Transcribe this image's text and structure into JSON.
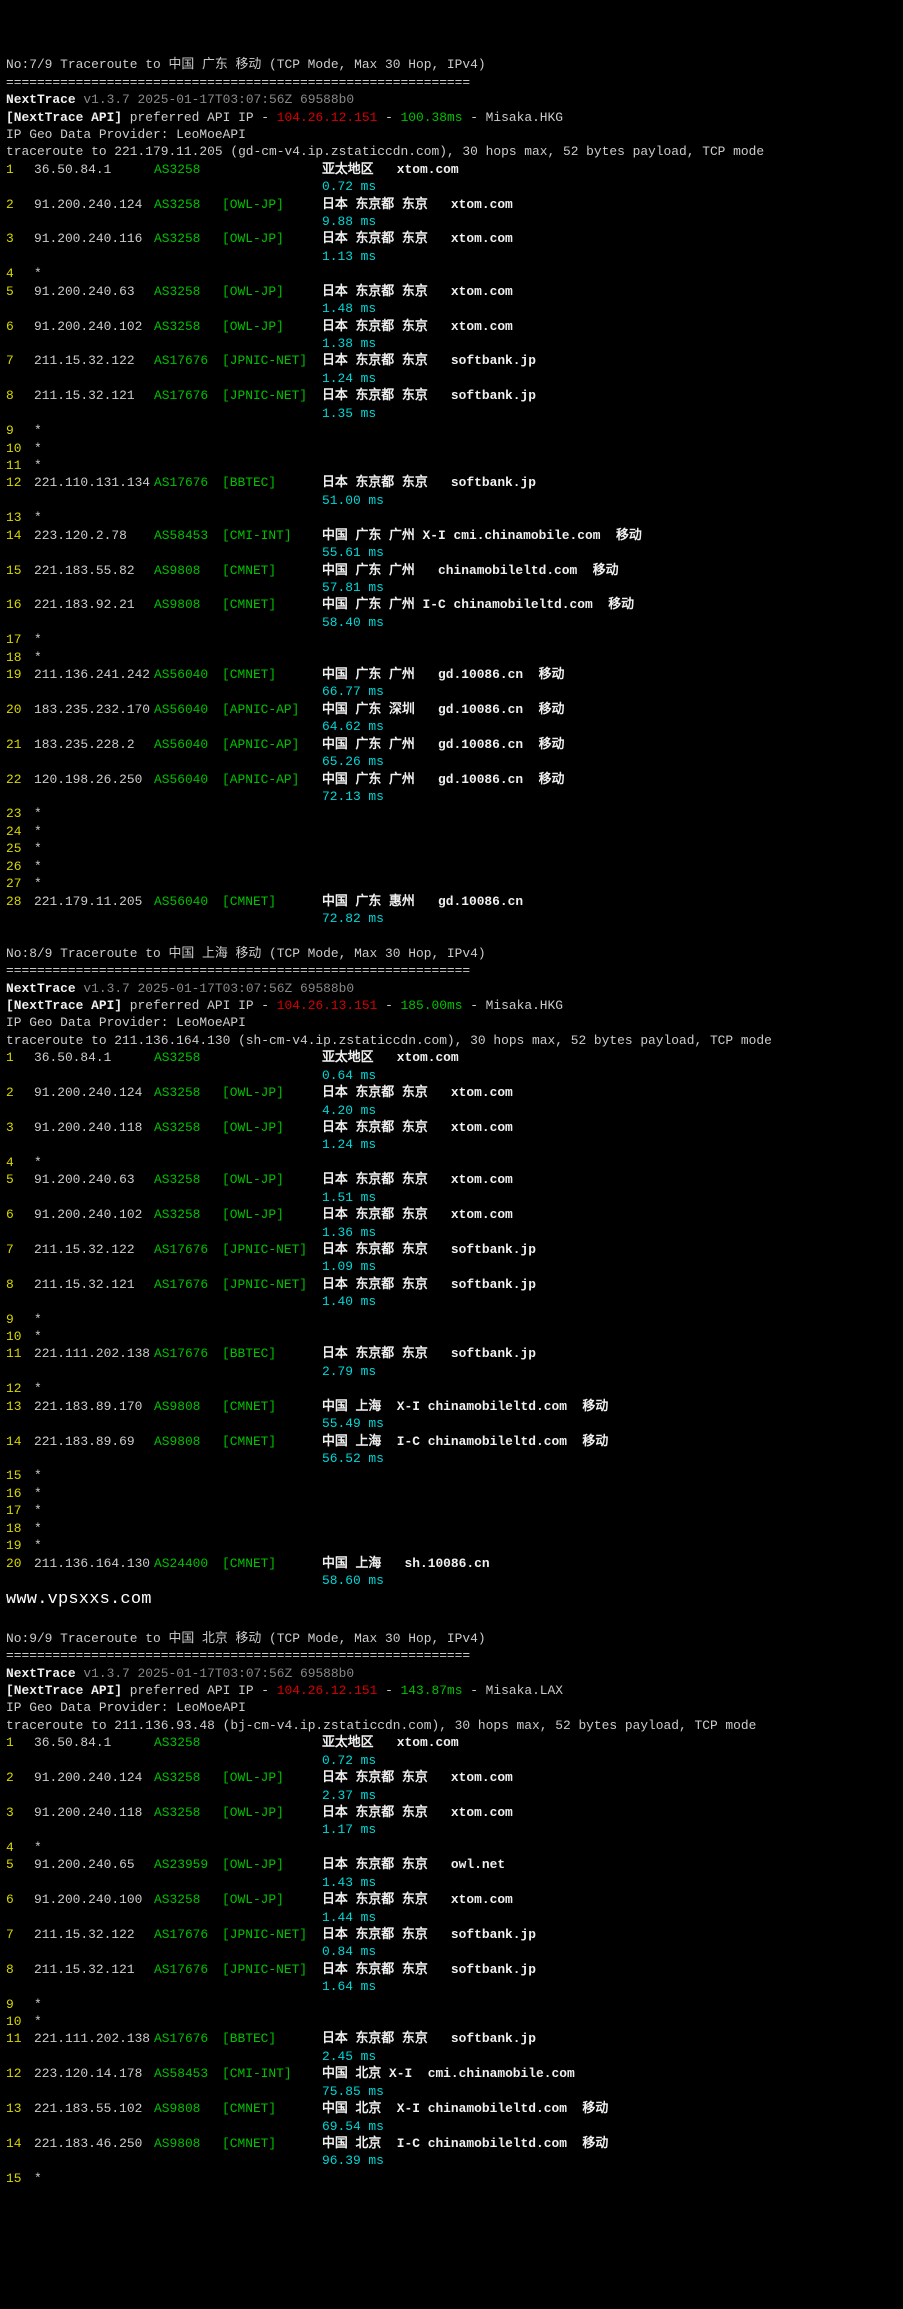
{
  "traces": [
    {
      "header": "No:7/9 Traceroute to 中国 广东 移动 (TCP Mode, Max 30 Hop, IPv4)",
      "sep": "============================================================",
      "nt_label": "NextTrace",
      "nt_ver": "v1.3.7 2025-01-17T03:07:56Z 69588b0",
      "api_tag": "[NextTrace API]",
      "api_txt": " preferred API IP - ",
      "api_ip": "104.26.12.151",
      "api_dash": " - ",
      "api_ms": "100.38ms",
      "api_loc": " - Misaka.HKG",
      "geo": "IP Geo Data Provider: LeoMoeAPI",
      "tline": "traceroute to 221.179.11.205 (gd-cm-v4.ip.zstaticcdn.com), 30 hops max, 52 bytes payload, TCP mode",
      "hops": [
        {
          "n": "1",
          "ip": "36.50.84.1",
          "as": "AS3258",
          "tag": "",
          "loc": "亚太地区   xtom.com",
          "ms": "0.72 ms"
        },
        {
          "n": "2",
          "ip": "91.200.240.124",
          "as": "AS3258",
          "tag": "[OWL-JP]",
          "loc": "日本 东京都 东京   xtom.com",
          "ms": "9.88 ms"
        },
        {
          "n": "3",
          "ip": "91.200.240.116",
          "as": "AS3258",
          "tag": "[OWL-JP]",
          "loc": "日本 东京都 东京   xtom.com",
          "ms": "1.13 ms"
        },
        {
          "n": "4",
          "ip": "*"
        },
        {
          "n": "5",
          "ip": "91.200.240.63",
          "as": "AS3258",
          "tag": "[OWL-JP]",
          "loc": "日本 东京都 东京   xtom.com",
          "ms": "1.48 ms"
        },
        {
          "n": "6",
          "ip": "91.200.240.102",
          "as": "AS3258",
          "tag": "[OWL-JP]",
          "loc": "日本 东京都 东京   xtom.com",
          "ms": "1.38 ms"
        },
        {
          "n": "7",
          "ip": "211.15.32.122",
          "as": "AS17676",
          "tag": "[JPNIC-NET]",
          "loc": "日本 东京都 东京   softbank.jp",
          "ms": "1.24 ms"
        },
        {
          "n": "8",
          "ip": "211.15.32.121",
          "as": "AS17676",
          "tag": "[JPNIC-NET]",
          "loc": "日本 东京都 东京   softbank.jp",
          "ms": "1.35 ms"
        },
        {
          "n": "9",
          "ip": "*"
        },
        {
          "n": "10",
          "ip": "*"
        },
        {
          "n": "11",
          "ip": "*"
        },
        {
          "n": "12",
          "ip": "221.110.131.134",
          "as": "AS17676",
          "tag": "[BBTEC]",
          "loc": "日本 东京都 东京   softbank.jp",
          "ms": "51.00 ms"
        },
        {
          "n": "13",
          "ip": "*"
        },
        {
          "n": "14",
          "ip": "223.120.2.78",
          "as": "AS58453",
          "tag": "[CMI-INT]",
          "loc": "中国 广东 广州 X-I cmi.chinamobile.com  移动",
          "ms": "55.61 ms"
        },
        {
          "n": "15",
          "ip": "221.183.55.82",
          "as": "AS9808",
          "tag": "[CMNET]",
          "loc": "中国 广东 广州   chinamobileltd.com  移动",
          "ms": "57.81 ms"
        },
        {
          "n": "16",
          "ip": "221.183.92.21",
          "as": "AS9808",
          "tag": "[CMNET]",
          "loc": "中国 广东 广州 I-C chinamobileltd.com  移动",
          "ms": "58.40 ms"
        },
        {
          "n": "17",
          "ip": "*"
        },
        {
          "n": "18",
          "ip": "*"
        },
        {
          "n": "19",
          "ip": "211.136.241.242",
          "as": "AS56040",
          "tag": "[CMNET]",
          "loc": "中国 广东 广州   gd.10086.cn  移动",
          "ms": "66.77 ms"
        },
        {
          "n": "20",
          "ip": "183.235.232.170",
          "as": "AS56040",
          "tag": "[APNIC-AP]",
          "loc": "中国 广东 深圳   gd.10086.cn  移动",
          "ms": "64.62 ms"
        },
        {
          "n": "21",
          "ip": "183.235.228.2",
          "as": "AS56040",
          "tag": "[APNIC-AP]",
          "loc": "中国 广东 广州   gd.10086.cn  移动",
          "ms": "65.26 ms"
        },
        {
          "n": "22",
          "ip": "120.198.26.250",
          "as": "AS56040",
          "tag": "[APNIC-AP]",
          "loc": "中国 广东 广州   gd.10086.cn  移动",
          "ms": "72.13 ms"
        },
        {
          "n": "23",
          "ip": "*"
        },
        {
          "n": "24",
          "ip": "*"
        },
        {
          "n": "25",
          "ip": "*"
        },
        {
          "n": "26",
          "ip": "*"
        },
        {
          "n": "27",
          "ip": "*"
        },
        {
          "n": "28",
          "ip": "221.179.11.205",
          "as": "AS56040",
          "tag": "[CMNET]",
          "loc": "中国 广东 惠州   gd.10086.cn",
          "ms": "72.82 ms"
        }
      ]
    },
    {
      "header": "No:8/9 Traceroute to 中国 上海 移动 (TCP Mode, Max 30 Hop, IPv4)",
      "sep": "============================================================",
      "nt_label": "NextTrace",
      "nt_ver": "v1.3.7 2025-01-17T03:07:56Z 69588b0",
      "api_tag": "[NextTrace API]",
      "api_txt": " preferred API IP - ",
      "api_ip": "104.26.13.151",
      "api_dash": " - ",
      "api_ms": "185.00ms",
      "api_loc": " - Misaka.HKG",
      "geo": "IP Geo Data Provider: LeoMoeAPI",
      "tline": "traceroute to 211.136.164.130 (sh-cm-v4.ip.zstaticcdn.com), 30 hops max, 52 bytes payload, TCP mode",
      "hops": [
        {
          "n": "1",
          "ip": "36.50.84.1",
          "as": "AS3258",
          "tag": "",
          "loc": "亚太地区   xtom.com",
          "ms": "0.64 ms"
        },
        {
          "n": "2",
          "ip": "91.200.240.124",
          "as": "AS3258",
          "tag": "[OWL-JP]",
          "loc": "日本 东京都 东京   xtom.com",
          "ms": "4.20 ms"
        },
        {
          "n": "3",
          "ip": "91.200.240.118",
          "as": "AS3258",
          "tag": "[OWL-JP]",
          "loc": "日本 东京都 东京   xtom.com",
          "ms": "1.24 ms"
        },
        {
          "n": "4",
          "ip": "*"
        },
        {
          "n": "5",
          "ip": "91.200.240.63",
          "as": "AS3258",
          "tag": "[OWL-JP]",
          "loc": "日本 东京都 东京   xtom.com",
          "ms": "1.51 ms"
        },
        {
          "n": "6",
          "ip": "91.200.240.102",
          "as": "AS3258",
          "tag": "[OWL-JP]",
          "loc": "日本 东京都 东京   xtom.com",
          "ms": "1.36 ms"
        },
        {
          "n": "7",
          "ip": "211.15.32.122",
          "as": "AS17676",
          "tag": "[JPNIC-NET]",
          "loc": "日本 东京都 东京   softbank.jp",
          "ms": "1.09 ms"
        },
        {
          "n": "8",
          "ip": "211.15.32.121",
          "as": "AS17676",
          "tag": "[JPNIC-NET]",
          "loc": "日本 东京都 东京   softbank.jp",
          "ms": "1.40 ms"
        },
        {
          "n": "9",
          "ip": "*"
        },
        {
          "n": "10",
          "ip": "*"
        },
        {
          "n": "11",
          "ip": "221.111.202.138",
          "as": "AS17676",
          "tag": "[BBTEC]",
          "loc": "日本 东京都 东京   softbank.jp",
          "ms": "2.79 ms"
        },
        {
          "n": "12",
          "ip": "*"
        },
        {
          "n": "13",
          "ip": "221.183.89.170",
          "as": "AS9808",
          "tag": "[CMNET]",
          "loc": "中国 上海  X-I chinamobileltd.com  移动",
          "ms": "55.49 ms"
        },
        {
          "n": "14",
          "ip": "221.183.89.69",
          "as": "AS9808",
          "tag": "[CMNET]",
          "loc": "中国 上海  I-C chinamobileltd.com  移动",
          "ms": "56.52 ms"
        },
        {
          "n": "15",
          "ip": "*"
        },
        {
          "n": "16",
          "ip": "*"
        },
        {
          "n": "17",
          "ip": "*"
        },
        {
          "n": "18",
          "ip": "*"
        },
        {
          "n": "19",
          "ip": "*"
        },
        {
          "n": "20",
          "ip": "211.136.164.130",
          "as": "AS24400",
          "tag": "[CMNET]",
          "loc": "中国 上海   sh.10086.cn",
          "ms": "58.60 ms"
        }
      ],
      "watermark": "www.vpsxxs.com"
    },
    {
      "header": "No:9/9 Traceroute to 中国 北京 移动 (TCP Mode, Max 30 Hop, IPv4)",
      "sep": "============================================================",
      "nt_label": "NextTrace",
      "nt_ver": "v1.3.7 2025-01-17T03:07:56Z 69588b0",
      "api_tag": "[NextTrace API]",
      "api_txt": " preferred API IP - ",
      "api_ip": "104.26.12.151",
      "api_dash": " - ",
      "api_ms": "143.87ms",
      "api_loc": " - Misaka.LAX",
      "geo": "IP Geo Data Provider: LeoMoeAPI",
      "tline": "traceroute to 211.136.93.48 (bj-cm-v4.ip.zstaticcdn.com), 30 hops max, 52 bytes payload, TCP mode",
      "hops": [
        {
          "n": "1",
          "ip": "36.50.84.1",
          "as": "AS3258",
          "tag": "",
          "loc": "亚太地区   xtom.com",
          "ms": "0.72 ms"
        },
        {
          "n": "2",
          "ip": "91.200.240.124",
          "as": "AS3258",
          "tag": "[OWL-JP]",
          "loc": "日本 东京都 东京   xtom.com",
          "ms": "2.37 ms"
        },
        {
          "n": "3",
          "ip": "91.200.240.118",
          "as": "AS3258",
          "tag": "[OWL-JP]",
          "loc": "日本 东京都 东京   xtom.com",
          "ms": "1.17 ms"
        },
        {
          "n": "4",
          "ip": "*"
        },
        {
          "n": "5",
          "ip": "91.200.240.65",
          "as": "AS23959",
          "tag": "[OWL-JP]",
          "loc": "日本 东京都 东京   owl.net",
          "ms": "1.43 ms"
        },
        {
          "n": "6",
          "ip": "91.200.240.100",
          "as": "AS3258",
          "tag": "[OWL-JP]",
          "loc": "日本 东京都 东京   xtom.com",
          "ms": "1.44 ms"
        },
        {
          "n": "7",
          "ip": "211.15.32.122",
          "as": "AS17676",
          "tag": "[JPNIC-NET]",
          "loc": "日本 东京都 东京   softbank.jp",
          "ms": "0.84 ms"
        },
        {
          "n": "8",
          "ip": "211.15.32.121",
          "as": "AS17676",
          "tag": "[JPNIC-NET]",
          "loc": "日本 东京都 东京   softbank.jp",
          "ms": "1.64 ms"
        },
        {
          "n": "9",
          "ip": "*"
        },
        {
          "n": "10",
          "ip": "*"
        },
        {
          "n": "11",
          "ip": "221.111.202.138",
          "as": "AS17676",
          "tag": "[BBTEC]",
          "loc": "日本 东京都 东京   softbank.jp",
          "ms": "2.45 ms"
        },
        {
          "n": "12",
          "ip": "223.120.14.178",
          "as": "AS58453",
          "tag": "[CMI-INT]",
          "loc": "中国 北京 X-I  cmi.chinamobile.com",
          "ms": "75.85 ms"
        },
        {
          "n": "13",
          "ip": "221.183.55.102",
          "as": "AS9808",
          "tag": "[CMNET]",
          "loc": "中国 北京  X-I chinamobileltd.com  移动",
          "ms": "69.54 ms"
        },
        {
          "n": "14",
          "ip": "221.183.46.250",
          "as": "AS9808",
          "tag": "[CMNET]",
          "loc": "中国 北京  I-C chinamobileltd.com  移动",
          "ms": "96.39 ms"
        },
        {
          "n": "15",
          "ip": "*"
        }
      ]
    }
  ]
}
